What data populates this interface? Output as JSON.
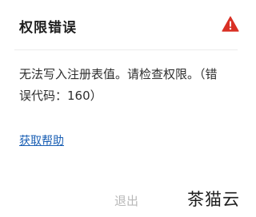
{
  "dialog": {
    "title": "权限错误",
    "icon": "warning-icon",
    "accent_color": "#d93025",
    "message": "无法写入注册表值。请检查权限。（错误代码：160）",
    "help_link": "获取帮助",
    "exit_label": "退出"
  },
  "watermark": "茶猫云"
}
